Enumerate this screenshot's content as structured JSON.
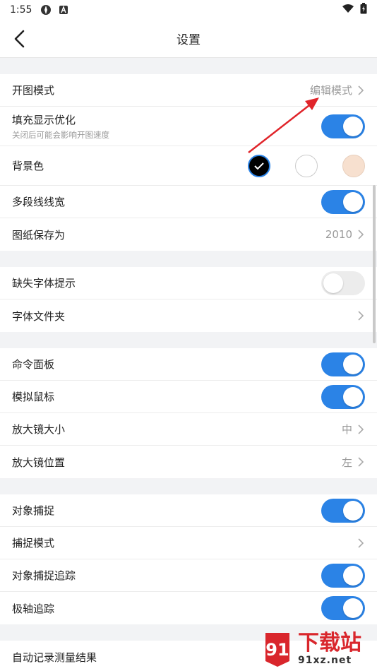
{
  "status": {
    "time": "1:55"
  },
  "header": {
    "title": "设置"
  },
  "groups": [
    {
      "rows": [
        {
          "label": "开图模式",
          "value": "编辑模式",
          "type": "nav"
        },
        {
          "label": "填充显示优化",
          "sub": "关闭后可能会影响开图速度",
          "type": "toggle",
          "on": true
        },
        {
          "label": "背景色",
          "type": "colors",
          "options": [
            "#000000",
            "#ffffff",
            "#f7e0cf"
          ],
          "selected": 0
        },
        {
          "label": "多段线线宽",
          "type": "toggle",
          "on": true
        },
        {
          "label": "图纸保存为",
          "value": "2010",
          "type": "nav"
        }
      ]
    },
    {
      "rows": [
        {
          "label": "缺失字体提示",
          "type": "toggle",
          "on": false
        },
        {
          "label": "字体文件夹",
          "type": "nav",
          "value": ""
        }
      ]
    },
    {
      "rows": [
        {
          "label": "命令面板",
          "type": "toggle",
          "on": true
        },
        {
          "label": "模拟鼠标",
          "type": "toggle",
          "on": true
        },
        {
          "label": "放大镜大小",
          "value": "中",
          "type": "nav"
        },
        {
          "label": "放大镜位置",
          "value": "左",
          "type": "nav"
        }
      ]
    },
    {
      "rows": [
        {
          "label": "对象捕捉",
          "type": "toggle",
          "on": true
        },
        {
          "label": "捕捉模式",
          "type": "nav",
          "value": ""
        },
        {
          "label": "对象捕捉追踪",
          "type": "toggle",
          "on": true
        },
        {
          "label": "极轴追踪",
          "type": "toggle",
          "on": true
        }
      ]
    },
    {
      "rows": [
        {
          "label": "自动记录测量结果",
          "type": "plain"
        }
      ]
    }
  ],
  "watermark": {
    "big": "下载站",
    "small": "91xz.net"
  },
  "colors": {
    "accent": "#2b83e6",
    "arrow": "#e0242a"
  }
}
